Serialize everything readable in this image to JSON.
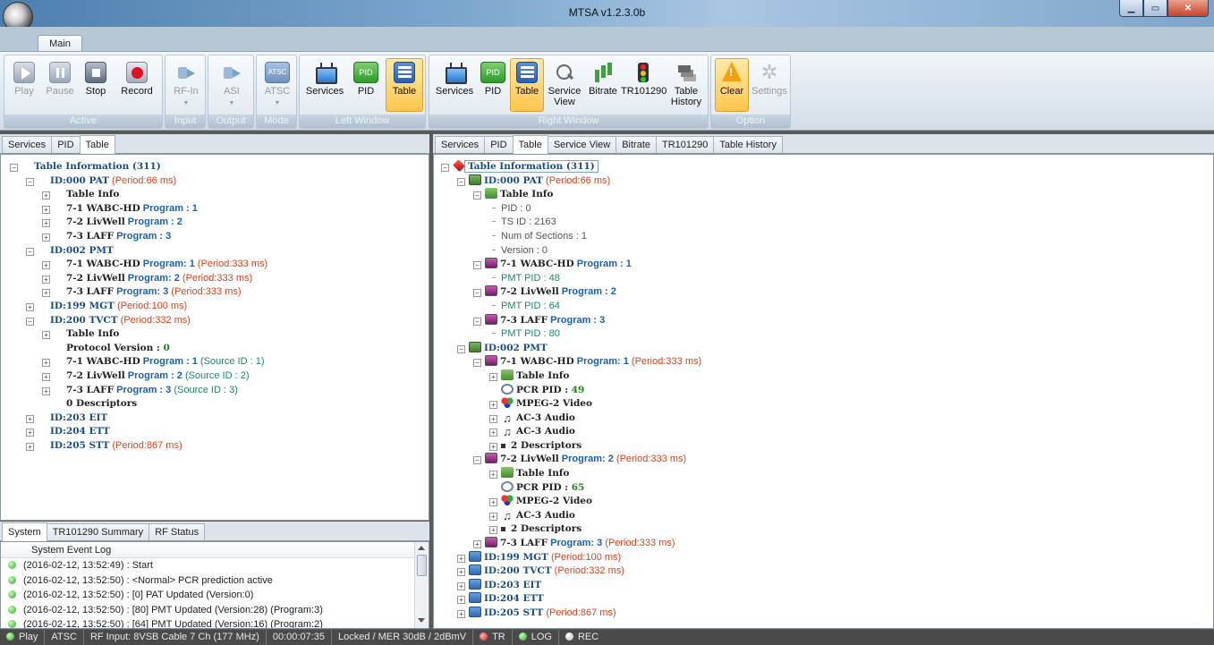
{
  "window": {
    "title": "MTSA v1.2.3.0b"
  },
  "main_tab": "Main",
  "ribbon": {
    "groups": {
      "active": "Active",
      "input": "Input",
      "output": "Output",
      "mode": "Mode",
      "left_window": "Left Window",
      "right_window": "Right Window",
      "option": "Option"
    },
    "buttons": {
      "play": "Play",
      "pause": "Pause",
      "stop": "Stop",
      "record": "Record",
      "rf_in": "RF-In",
      "asi": "ASI",
      "atsc": "ATSC",
      "atsc_icon_text": "ATSC",
      "services": "Services",
      "pid": "PID",
      "pid_icon_text": "PID",
      "table": "Table",
      "service_view": "Service View",
      "bitrate": "Bitrate",
      "tr101290": "TR101290",
      "table_history": "Table History",
      "clear": "Clear",
      "settings": "Settings"
    }
  },
  "left_tabs": [
    "Services",
    "PID",
    "Table"
  ],
  "right_tabs": [
    "Services",
    "PID",
    "Table",
    "Service View",
    "Bitrate",
    "TR101290",
    "Table History"
  ],
  "bottom_tabs": [
    "System",
    "TR101290 Summary",
    "RF Status"
  ],
  "left_tree": {
    "root": "Table Information  (311)",
    "pat": {
      "id": "ID:000  PAT",
      "period": "(Period:66 ms)"
    },
    "pat_children": {
      "table_info": "Table Info",
      "p1_name": "7-1 WABC-HD",
      "p1_prog": "Program : 1",
      "p2_name": "7-2 LivWell",
      "p2_prog": "Program : 2",
      "p3_name": "7-3 LAFF",
      "p3_prog": "Program : 3"
    },
    "pmt": {
      "id": "ID:002  PMT"
    },
    "pmt_children": {
      "p1_name": "7-1 WABC-HD",
      "p1_prog": "Program: 1",
      "p1_period": "(Period:333 ms)",
      "p2_name": "7-2 LivWell",
      "p2_prog": "Program: 2",
      "p2_period": "(Period:333 ms)",
      "p3_name": "7-3 LAFF",
      "p3_prog": "Program: 3",
      "p3_period": "(Period:333 ms)"
    },
    "mgt": {
      "id": "ID:199  MGT",
      "period": "(Period:100 ms)"
    },
    "tvct": {
      "id": "ID:200  TVCT",
      "period": "(Period:332 ms)"
    },
    "tvct_children": {
      "table_info": "Table Info",
      "protocol_label": "Protocol Version : ",
      "protocol_value": "0",
      "p1_name": "7-1 WABC-HD",
      "p1_prog": "Program : 1",
      "p1_src": "(Source ID : 1)",
      "p2_name": "7-2 LivWell",
      "p2_prog": "Program : 2",
      "p2_src": "(Source ID : 2)",
      "p3_name": "7-3 LAFF",
      "p3_prog": "Program : 3",
      "p3_src": "(Source ID : 3)",
      "descriptors": "0 Descriptors"
    },
    "eit": {
      "id": "ID:203  EIT"
    },
    "ett": {
      "id": "ID:204  ETT"
    },
    "stt": {
      "id": "ID:205  STT",
      "period": "(Period:867 ms)"
    }
  },
  "right_tree": {
    "root": "Table Information  (311)",
    "pat": {
      "id": "ID:000  PAT",
      "period": "(Period:66 ms)"
    },
    "pat_info": "Table Info",
    "pat_fields": {
      "pid": "PID : 0",
      "ts_id": "TS ID : 2163",
      "sections": "Num of Sections : 1",
      "version": "Version : 0"
    },
    "pat_p1": {
      "name": "7-1 WABC-HD",
      "prog": "Program : 1",
      "pmt_pid": "PMT PID : 48"
    },
    "pat_p2": {
      "name": "7-2 LivWell",
      "prog": "Program : 2",
      "pmt_pid": "PMT PID : 64"
    },
    "pat_p3": {
      "name": "7-3 LAFF",
      "prog": "Program : 3",
      "pmt_pid": "PMT PID : 80"
    },
    "pmt": {
      "id": "ID:002  PMT"
    },
    "pmt_p1": {
      "name": "7-1 WABC-HD",
      "prog": "Program: 1",
      "period": "(Period:333 ms)",
      "info": "Table Info",
      "pcr_label": "PCR PID : ",
      "pcr_value": "49",
      "video": "MPEG-2 Video",
      "audio1": "AC-3 Audio",
      "audio2": "AC-3 Audio",
      "desc": "2 Descriptors"
    },
    "pmt_p2": {
      "name": "7-2 LivWell",
      "prog": "Program: 2",
      "period": "(Period:333 ms)",
      "info": "Table Info",
      "pcr_label": "PCR PID : ",
      "pcr_value": "65",
      "video": "MPEG-2 Video",
      "audio1": "AC-3 Audio",
      "desc": "2 Descriptors"
    },
    "pmt_p3": {
      "name": "7-3 LAFF",
      "prog": "Program: 3",
      "period": "(Period:333 ms)"
    },
    "mgt": {
      "id": "ID:199  MGT",
      "period": "(Period:100 ms)"
    },
    "tvct": {
      "id": "ID:200  TVCT",
      "period": "(Period:332 ms)"
    },
    "eit": {
      "id": "ID:203  EIT"
    },
    "ett": {
      "id": "ID:204  ETT"
    },
    "stt": {
      "id": "ID:205  STT",
      "period": "(Period:867 ms)"
    }
  },
  "log": {
    "header": "System Event Log",
    "entries": [
      "(2016-02-12, 13:52:49) : Start",
      "(2016-02-12, 13:52:50) : <Normal> PCR prediction active",
      "(2016-02-12, 13:52:50) : [0] PAT Updated (Version:0)",
      "(2016-02-12, 13:52:50) : [80] PMT Updated (Version:28) (Program:3)",
      "(2016-02-12, 13:52:50) : [64] PMT Updated (Version:16) (Program:2)"
    ]
  },
  "status": {
    "play": "Play",
    "standard": "ATSC",
    "rf_input": "RF Input: 8VSB Cable 7 Ch (177 MHz)",
    "elapsed": "00:00:07:35",
    "lock": "Locked / MER 30dB / 2dBmV",
    "tr": "TR",
    "log": "LOG",
    "rec": "REC"
  },
  "colors": {
    "accent_active": "#ffc64c",
    "tree_label": "#1a4c8a",
    "period": "#e0401a",
    "status_bg": "#4a4a4a"
  }
}
